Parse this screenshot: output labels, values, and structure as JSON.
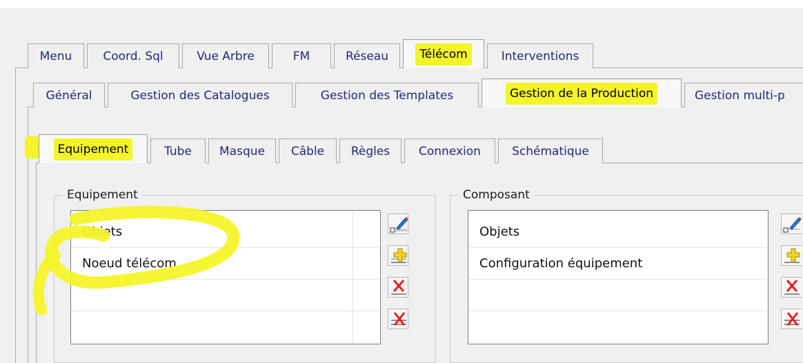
{
  "main_tabs": [
    "Menu",
    "Coord. Sql",
    "Vue Arbre",
    "FM",
    "Réseau",
    "Télécom",
    "Interventions"
  ],
  "main_active": "Télécom",
  "sub_tabs": [
    "Général",
    "Gestion des Catalogues",
    "Gestion des Templates",
    "Gestion de la Production",
    "Gestion multi-p"
  ],
  "sub_active": "Gestion de la Production",
  "inner_tabs": [
    "Equipement",
    "Tube",
    "Masque",
    "Câble",
    "Règles",
    "Connexion",
    "Schématique"
  ],
  "inner_active": "Equipement",
  "equipement_group": {
    "title": "Equipement",
    "items": [
      "Objets",
      "Noeud télécom"
    ]
  },
  "composant_group": {
    "title": "Composant",
    "items": [
      "Objets",
      "Configuration équipement"
    ]
  },
  "icons": [
    "edit-pencil-icon",
    "add-plus-icon",
    "delete-x-icon",
    "delete-all-x-icon"
  ],
  "colors": {
    "highlight": "#f4f42a",
    "tab_text": "#1f2a7a",
    "panel_bg": "#f0f0f0"
  }
}
